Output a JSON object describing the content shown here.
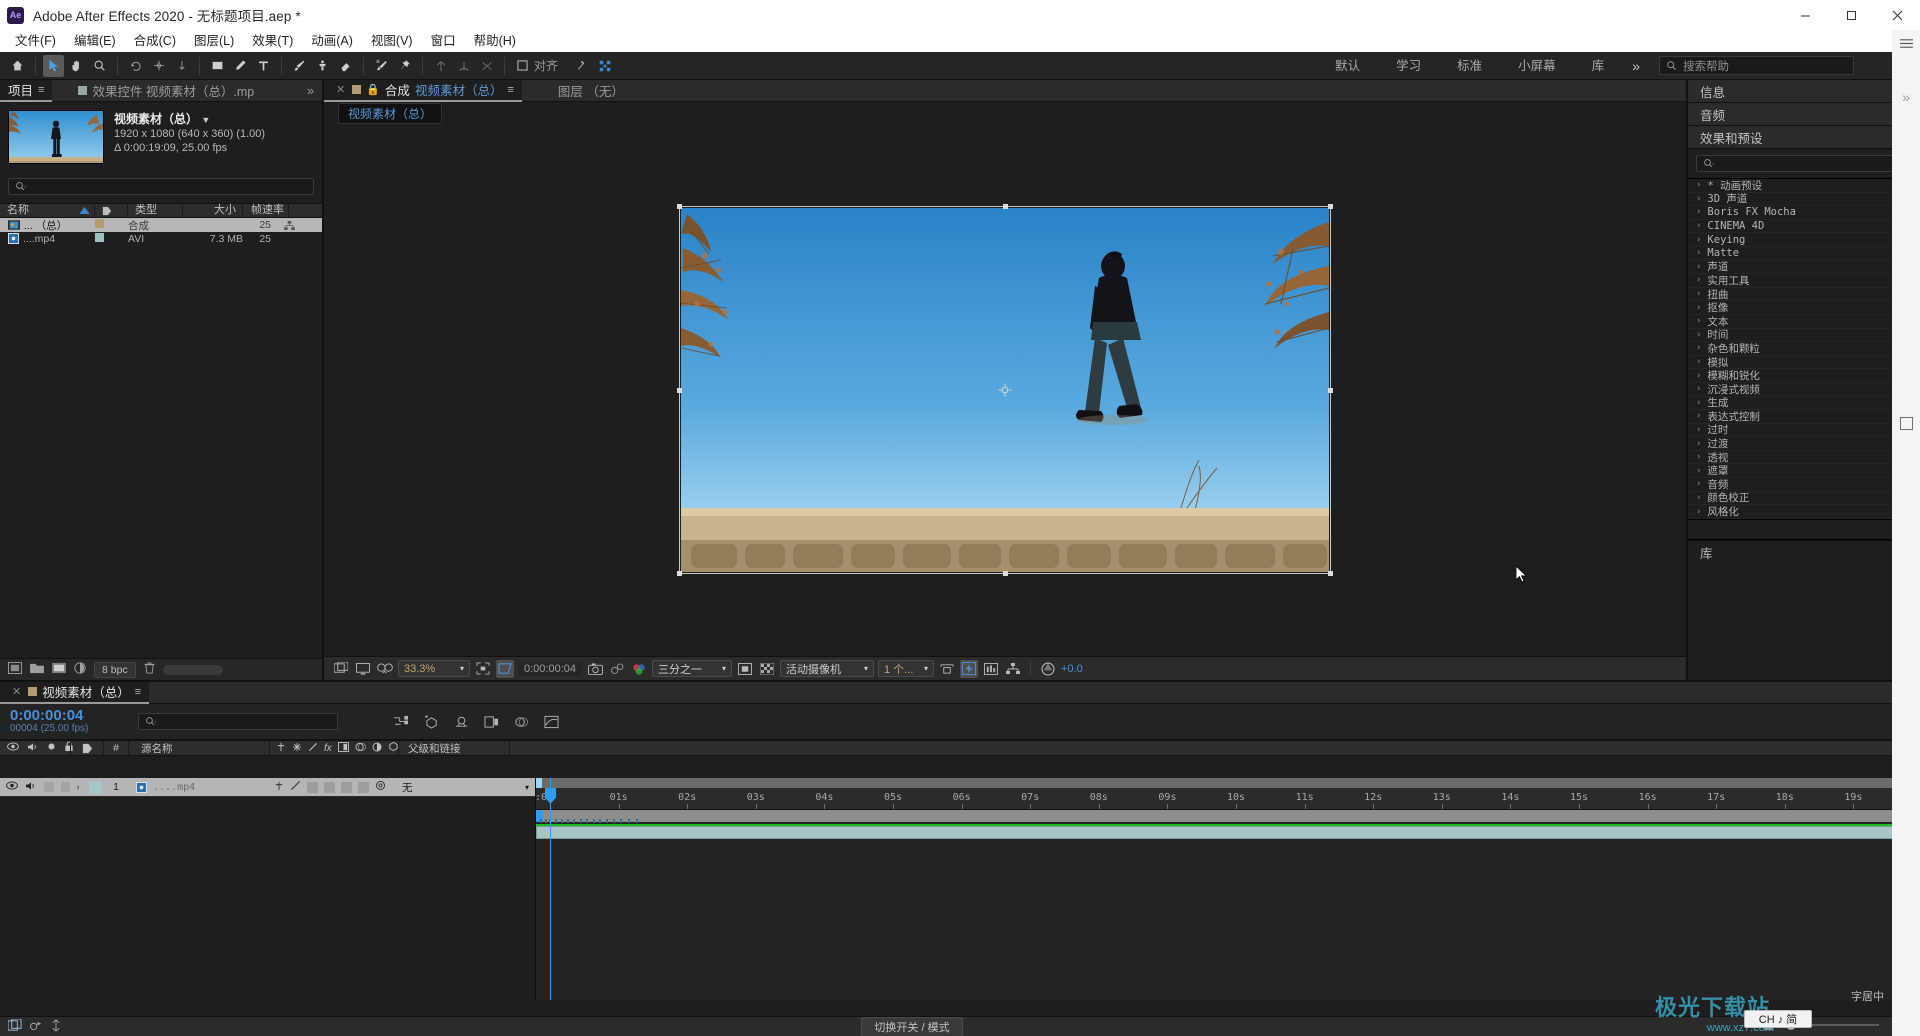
{
  "window": {
    "app_icon": "Ae",
    "title": "Adobe After Effects 2020 - 无标题项目.aep *",
    "minimize": "—",
    "maximize": "▢",
    "close": "✕"
  },
  "menubar": {
    "items": [
      "文件(F)",
      "编辑(E)",
      "合成(C)",
      "图层(L)",
      "效果(T)",
      "动画(A)",
      "视图(V)",
      "窗口",
      "帮助(H)"
    ]
  },
  "toolbar": {
    "align_label": "对齐",
    "workspaces": [
      "默认",
      "学习",
      "标准",
      "小屏幕",
      "库"
    ],
    "workspace_more": "»",
    "search_placeholder": "搜索帮助",
    "search_icon": "search-icon"
  },
  "project_panel": {
    "tabs": [
      {
        "label": "项目",
        "active": true
      },
      {
        "label": "效果控件 视频素材（总）.mp",
        "active": false
      }
    ],
    "overflow": "»",
    "preview": {
      "name": "视频素材（总）",
      "dimensions": "1920 x 1080  (640 x 360) (1.00)",
      "duration": "Δ 0:00:19:09, 25.00 fps"
    },
    "search_placeholder": "",
    "columns": [
      "名称",
      "类型",
      "大小",
      "帧速率"
    ],
    "rows": [
      {
        "name": "... （总）",
        "type": "合成",
        "size": "",
        "fps": "25",
        "selected": true
      },
      {
        "name": "....mp4",
        "type": "AVI",
        "size": "7.3 MB",
        "fps": "25",
        "selected": false
      }
    ],
    "footer": {
      "bpc": "8 bpc"
    }
  },
  "composition_viewer": {
    "tabs": [
      {
        "label_prefix": "合成",
        "label_name": "视频素材（总）",
        "active": true
      },
      {
        "label": "图层 （无）",
        "active": false
      }
    ],
    "breadcrumb": "视频素材（总）",
    "bottom_bar": {
      "zoom": "33.3%",
      "time": "0:00:00:04",
      "grid_select": "三分之一",
      "camera_select": "活动摄像机",
      "views_select": "1 个...",
      "exposure": "+0.0"
    }
  },
  "right_panel": {
    "info_tab": "信息",
    "audio_tab": "音频",
    "effects_tab": "效果和预设",
    "effects_search_placeholder": "",
    "effects": [
      "* 动画预设",
      "3D 声道",
      "Boris FX Mocha",
      "CINEMA 4D",
      "Keying",
      "Matte",
      "声道",
      "实用工具",
      "扭曲",
      "抠像",
      "文本",
      "时间",
      "杂色和颗粒",
      "模拟",
      "模糊和锐化",
      "沉浸式视频",
      "生成",
      "表达式控制",
      "过时",
      "过渡",
      "透视",
      "遮罩",
      "音频",
      "颜色校正",
      "风格化"
    ],
    "library_tab": "库"
  },
  "timeline": {
    "tab_label": "视频素材（总）",
    "current_time": "0:00:00:04",
    "frame_info": "00004 (25.00 fps)",
    "search_placeholder": "",
    "columns": {
      "source_name": "源名称",
      "hash": "#",
      "parent": "父级和链接"
    },
    "layer": {
      "index": "1",
      "name": "....mp4",
      "parent": "无",
      "mode_dropdown": "无"
    },
    "ruler_ticks": [
      "01s",
      "02s",
      "03s",
      "04s",
      "05s",
      "06s",
      "07s",
      "08s",
      "09s",
      "10s",
      "11s",
      "12s",
      "13s",
      "14s",
      "15s",
      "16s",
      "17s",
      "18s",
      "19s"
    ],
    "ruler_start": ":00",
    "footer_toggle": "切换开关 / 模式"
  },
  "overlay": {
    "ime_text": "CH ♪ 简",
    "float_text": "字居中",
    "watermark": "极光下载站",
    "watermark_url": "www.xz7.com"
  },
  "colors": {
    "accent_blue": "#2e9cf0",
    "link_blue": "#5b9bd5",
    "panel_bg": "#1e1e1e",
    "tab_bg": "#2b2b2b",
    "selection": "#b7b7b7",
    "green_bar": "#1fbb1f",
    "clip_bar": "#a9c6c6"
  }
}
